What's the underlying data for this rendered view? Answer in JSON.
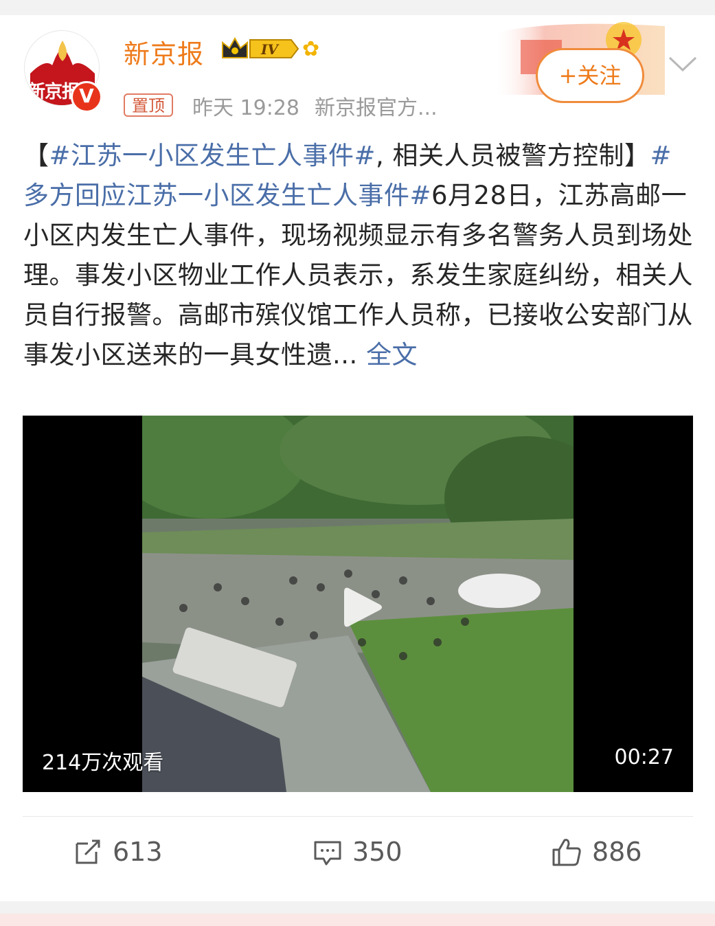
{
  "header": {
    "account_name": "新京报",
    "avatar_text": "新京报",
    "level_badge": "IV",
    "verified_mark": "V",
    "pinned_tag": "置顶",
    "time": "昨天 19:28",
    "source": "新京报官方...",
    "follow_label": "+关注"
  },
  "post": {
    "bracket_open": "【",
    "hashtag1": "#江苏一小区发生亡人事件#",
    "title_rest": ", 相关人员被警方控制】",
    "hashtag2": "#多方回应江苏一小区发生亡人事件#",
    "body": "6月28日，江苏高邮一小区内发生亡人事件，现场视频显示有多名警务人员到场处理。事发小区物业工作人员表示，系发生家庭纠纷，相关人员自行报警。高邮市殡仪馆工作人员称，已接收公安部门从事发小区送来的一具女性遗...",
    "more_link": "全文"
  },
  "video": {
    "views": "214万次观看",
    "duration": "00:27"
  },
  "actions": {
    "reposts": "613",
    "comments": "350",
    "likes": "886"
  },
  "colors": {
    "brand_orange": "#ee7b1b",
    "hashtag_blue": "#4a6ea8",
    "verified_red": "#e8331b"
  },
  "icons": [
    "repost-icon",
    "comment-icon",
    "like-icon",
    "play-icon",
    "chevron-down-icon",
    "verified-icon",
    "crown-icon",
    "sunflower-icon"
  ]
}
